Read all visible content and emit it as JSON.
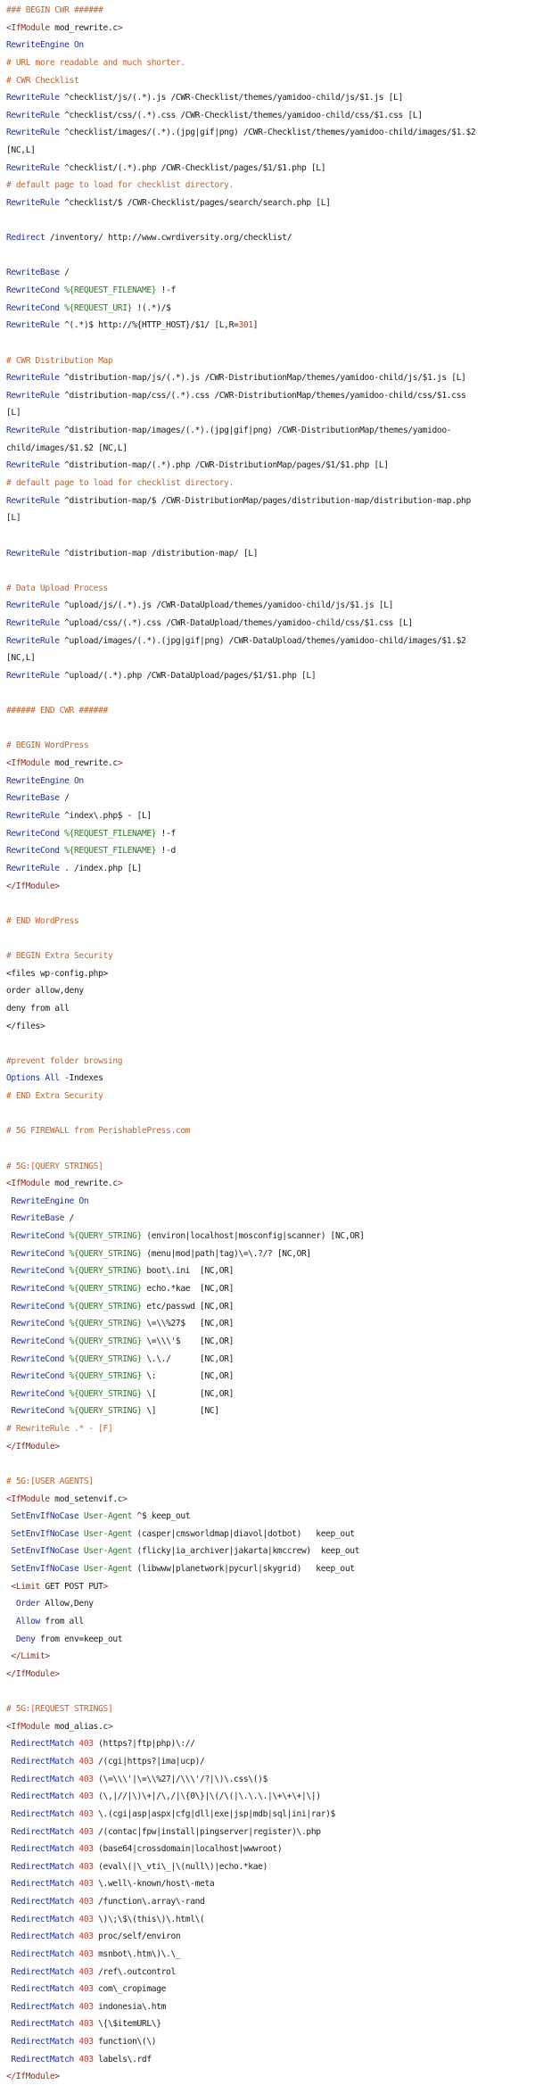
{
  "colors": {
    "comment": "#c0632e",
    "keyword": "#1f2fa0",
    "tag": "#8a2a1e",
    "variable": "#2f7a2a",
    "number": "#c0392b",
    "text": "#1a1a1a",
    "background": "#ffffff"
  },
  "lines": [
    [
      [
        "comment",
        "### BEGIN CWR ######"
      ]
    ],
    [
      [
        "tag",
        "<IfModule "
      ],
      [
        "text",
        "mod_rewrite.c"
      ],
      [
        "tag",
        ">"
      ]
    ],
    [
      [
        "keyword",
        "RewriteEngine On"
      ]
    ],
    [
      [
        "comment",
        "# URL more readable and much shorter."
      ]
    ],
    [
      [
        "comment",
        "# CWR Checklist"
      ]
    ],
    [
      [
        "keyword",
        "RewriteRule "
      ],
      [
        "text",
        "^checklist/js/(.*).js /CWR-Checklist/themes/yamidoo-child/js/$1.js [L]"
      ]
    ],
    [
      [
        "keyword",
        "RewriteRule "
      ],
      [
        "text",
        "^checklist/css/(.*).css /CWR-Checklist/themes/yamidoo-child/css/$1.css [L]"
      ]
    ],
    [
      [
        "keyword",
        "RewriteRule "
      ],
      [
        "text",
        "^checklist/images/(.*).(jpg|gif|png) /CWR-Checklist/themes/yamidoo-child/images/$1.$2"
      ]
    ],
    [
      [
        "text",
        "[NC,L]"
      ]
    ],
    [
      [
        "keyword",
        "RewriteRule "
      ],
      [
        "text",
        "^checklist/(.*).php /CWR-Checklist/pages/$1/$1.php [L]"
      ]
    ],
    [
      [
        "comment",
        "# default page to load for checklist directory."
      ]
    ],
    [
      [
        "keyword",
        "RewriteRule "
      ],
      [
        "text",
        "^checklist/$ /CWR-Checklist/pages/search/search.php [L]"
      ]
    ],
    [],
    [
      [
        "keyword",
        "Redirect "
      ],
      [
        "text",
        "/inventory/ http://www.cwrdiversity.org/checklist/"
      ]
    ],
    [],
    [
      [
        "keyword",
        "RewriteBase "
      ],
      [
        "text",
        "/"
      ]
    ],
    [
      [
        "keyword",
        "RewriteCond "
      ],
      [
        "var",
        "%{REQUEST_FILENAME}"
      ],
      [
        "text",
        " !-f"
      ]
    ],
    [
      [
        "keyword",
        "RewriteCond "
      ],
      [
        "var",
        "%{REQUEST_URI}"
      ],
      [
        "text",
        " !(.*)/$"
      ]
    ],
    [
      [
        "keyword",
        "RewriteRule "
      ],
      [
        "text",
        "^(.*)$ http://%{HTTP_HOST}/$1/ [L,R="
      ],
      [
        "num",
        "301"
      ],
      [
        "text",
        "]"
      ]
    ],
    [],
    [
      [
        "comment",
        "# CWR Distribution Map"
      ]
    ],
    [
      [
        "keyword",
        "RewriteRule "
      ],
      [
        "text",
        "^distribution-map/js/(.*).js /CWR-DistributionMap/themes/yamidoo-child/js/$1.js [L]"
      ]
    ],
    [
      [
        "keyword",
        "RewriteRule "
      ],
      [
        "text",
        "^distribution-map/css/(.*).css /CWR-DistributionMap/themes/yamidoo-child/css/$1.css"
      ]
    ],
    [
      [
        "text",
        "[L]"
      ]
    ],
    [
      [
        "keyword",
        "RewriteRule "
      ],
      [
        "text",
        "^distribution-map/images/(.*).(jpg|gif|png) /CWR-DistributionMap/themes/yamidoo-"
      ]
    ],
    [
      [
        "text",
        "child/images/$1.$2 [NC,L]"
      ]
    ],
    [
      [
        "keyword",
        "RewriteRule "
      ],
      [
        "text",
        "^distribution-map/(.*).php /CWR-DistributionMap/pages/$1/$1.php [L]"
      ]
    ],
    [
      [
        "comment",
        "# default page to load for checklist directory."
      ]
    ],
    [
      [
        "keyword",
        "RewriteRule "
      ],
      [
        "text",
        "^distribution-map/$ /CWR-DistributionMap/pages/distribution-map/distribution-map.php"
      ]
    ],
    [
      [
        "text",
        "[L]"
      ]
    ],
    [],
    [
      [
        "keyword",
        "RewriteRule "
      ],
      [
        "text",
        "^distribution-map /distribution-map/ [L]"
      ]
    ],
    [],
    [
      [
        "comment",
        "# Data Upload Process"
      ]
    ],
    [
      [
        "keyword",
        "RewriteRule "
      ],
      [
        "text",
        "^upload/js/(.*).js /CWR-DataUpload/themes/yamidoo-child/js/$1.js [L]"
      ]
    ],
    [
      [
        "keyword",
        "RewriteRule "
      ],
      [
        "text",
        "^upload/css/(.*).css /CWR-DataUpload/themes/yamidoo-child/css/$1.css [L]"
      ]
    ],
    [
      [
        "keyword",
        "RewriteRule "
      ],
      [
        "text",
        "^upload/images/(.*).(jpg|gif|png) /CWR-DataUpload/themes/yamidoo-child/images/$1.$2"
      ]
    ],
    [
      [
        "text",
        "[NC,L]"
      ]
    ],
    [
      [
        "keyword",
        "RewriteRule "
      ],
      [
        "text",
        "^upload/(.*).php /CWR-DataUpload/pages/$1/$1.php [L]"
      ]
    ],
    [],
    [
      [
        "comment",
        "###### END CWR ######"
      ]
    ],
    [],
    [
      [
        "comment",
        "# BEGIN WordPress"
      ]
    ],
    [
      [
        "tag",
        "<IfModule "
      ],
      [
        "text",
        "mod_rewrite.c"
      ],
      [
        "tag",
        ">"
      ]
    ],
    [
      [
        "keyword",
        "RewriteEngine On"
      ]
    ],
    [
      [
        "keyword",
        "RewriteBase "
      ],
      [
        "text",
        "/"
      ]
    ],
    [
      [
        "keyword",
        "RewriteRule "
      ],
      [
        "text",
        "^index\\.php$ - [L]"
      ]
    ],
    [
      [
        "keyword",
        "RewriteCond "
      ],
      [
        "var",
        "%{REQUEST_FILENAME}"
      ],
      [
        "text",
        " !-f"
      ]
    ],
    [
      [
        "keyword",
        "RewriteCond "
      ],
      [
        "var",
        "%{REQUEST_FILENAME}"
      ],
      [
        "text",
        " !-d"
      ]
    ],
    [
      [
        "keyword",
        "RewriteRule "
      ],
      [
        "text",
        ". /index.php [L]"
      ]
    ],
    [
      [
        "tag",
        "</IfModule>"
      ]
    ],
    [],
    [
      [
        "comment",
        "# END WordPress"
      ]
    ],
    [],
    [
      [
        "comment",
        "# BEGIN Extra Security"
      ]
    ],
    [
      [
        "text",
        "<files wp-config.php>"
      ]
    ],
    [
      [
        "text",
        "order allow,deny"
      ]
    ],
    [
      [
        "text",
        "deny from all"
      ]
    ],
    [
      [
        "text",
        "</files>"
      ]
    ],
    [],
    [
      [
        "comment",
        "#prevent folder browsing"
      ]
    ],
    [
      [
        "keyword",
        "Options All "
      ],
      [
        "text",
        "-Indexes"
      ]
    ],
    [
      [
        "comment",
        "# END Extra Security"
      ]
    ],
    [],
    [
      [
        "comment",
        "# 5G FIREWALL from PerishablePress.com"
      ]
    ],
    [],
    [
      [
        "comment",
        "# 5G:[QUERY STRINGS]"
      ]
    ],
    [
      [
        "tag",
        "<IfModule "
      ],
      [
        "text",
        "mod_rewrite.c"
      ],
      [
        "tag",
        ">"
      ]
    ],
    [
      [
        "keyword",
        " RewriteEngine On"
      ]
    ],
    [
      [
        "keyword",
        " RewriteBase "
      ],
      [
        "text",
        "/"
      ]
    ],
    [
      [
        "keyword",
        " RewriteCond "
      ],
      [
        "var",
        "%{QUERY_STRING}"
      ],
      [
        "text",
        " (environ|localhost|mosconfig|scanner) [NC,OR]"
      ]
    ],
    [
      [
        "keyword",
        " RewriteCond "
      ],
      [
        "var",
        "%{QUERY_STRING}"
      ],
      [
        "text",
        " (menu|mod|path|tag)\\=\\.?/? [NC,OR]"
      ]
    ],
    [
      [
        "keyword",
        " RewriteCond "
      ],
      [
        "var",
        "%{QUERY_STRING}"
      ],
      [
        "text",
        " boot\\.ini  [NC,OR]"
      ]
    ],
    [
      [
        "keyword",
        " RewriteCond "
      ],
      [
        "var",
        "%{QUERY_STRING}"
      ],
      [
        "text",
        " echo.*kae  [NC,OR]"
      ]
    ],
    [
      [
        "keyword",
        " RewriteCond "
      ],
      [
        "var",
        "%{QUERY_STRING}"
      ],
      [
        "text",
        " etc/passwd [NC,OR]"
      ]
    ],
    [
      [
        "keyword",
        " RewriteCond "
      ],
      [
        "var",
        "%{QUERY_STRING}"
      ],
      [
        "text",
        " \\=\\\\%27$   [NC,OR]"
      ]
    ],
    [
      [
        "keyword",
        " RewriteCond "
      ],
      [
        "var",
        "%{QUERY_STRING}"
      ],
      [
        "text",
        " \\=\\\\\\'$    [NC,OR]"
      ]
    ],
    [
      [
        "keyword",
        " RewriteCond "
      ],
      [
        "var",
        "%{QUERY_STRING}"
      ],
      [
        "text",
        " \\.\\./      [NC,OR]"
      ]
    ],
    [
      [
        "keyword",
        " RewriteCond "
      ],
      [
        "var",
        "%{QUERY_STRING}"
      ],
      [
        "text",
        " \\:         [NC,OR]"
      ]
    ],
    [
      [
        "keyword",
        " RewriteCond "
      ],
      [
        "var",
        "%{QUERY_STRING}"
      ],
      [
        "text",
        " \\[         [NC,OR]"
      ]
    ],
    [
      [
        "keyword",
        " RewriteCond "
      ],
      [
        "var",
        "%{QUERY_STRING}"
      ],
      [
        "text",
        " \\]         [NC]"
      ]
    ],
    [
      [
        "comment",
        "# RewriteRule .* - [F]"
      ]
    ],
    [
      [
        "tag",
        "</IfModule>"
      ]
    ],
    [],
    [
      [
        "comment",
        "# 5G:[USER AGENTS]"
      ]
    ],
    [
      [
        "tag",
        "<IfModule "
      ],
      [
        "text",
        "mod_setenvif.c"
      ],
      [
        "tag",
        ">"
      ]
    ],
    [
      [
        "keyword",
        " SetEnvIfNoCase "
      ],
      [
        "var",
        "User-Agent"
      ],
      [
        "text",
        " ^$ keep_out"
      ]
    ],
    [
      [
        "keyword",
        " SetEnvIfNoCase "
      ],
      [
        "var",
        "User-Agent"
      ],
      [
        "text",
        " (casper|cmsworldmap|diavol|dotbot)   keep_out"
      ]
    ],
    [
      [
        "keyword",
        " SetEnvIfNoCase "
      ],
      [
        "var",
        "User-Agent"
      ],
      [
        "text",
        " (flicky|ia_archiver|jakarta|kmccrew)  keep_out"
      ]
    ],
    [
      [
        "keyword",
        " SetEnvIfNoCase "
      ],
      [
        "var",
        "User-Agent"
      ],
      [
        "text",
        " (libwww|planetwork|pycurl|skygrid)   keep_out"
      ]
    ],
    [
      [
        "tag",
        " <Limit "
      ],
      [
        "text",
        "GET POST PUT"
      ],
      [
        "tag",
        ">"
      ]
    ],
    [
      [
        "keyword",
        "  Order "
      ],
      [
        "text",
        "Allow,Deny"
      ]
    ],
    [
      [
        "keyword",
        "  Allow "
      ],
      [
        "text",
        "from all"
      ]
    ],
    [
      [
        "keyword",
        "  Deny "
      ],
      [
        "text",
        "from env=keep_out"
      ]
    ],
    [
      [
        "tag",
        " </Limit>"
      ]
    ],
    [
      [
        "tag",
        "</IfModule>"
      ]
    ],
    [],
    [
      [
        "comment",
        "# 5G:[REQUEST STRINGS]"
      ]
    ],
    [
      [
        "tag",
        "<IfModule "
      ],
      [
        "text",
        "mod_alias.c"
      ],
      [
        "tag",
        ">"
      ]
    ],
    [
      [
        "keyword",
        " RedirectMatch "
      ],
      [
        "num",
        "403"
      ],
      [
        "text",
        " (https?|ftp|php)\\://"
      ]
    ],
    [
      [
        "keyword",
        " RedirectMatch "
      ],
      [
        "num",
        "403"
      ],
      [
        "text",
        " /(cgi|https?|ima|ucp)/"
      ]
    ],
    [
      [
        "keyword",
        " RedirectMatch "
      ],
      [
        "num",
        "403"
      ],
      [
        "text",
        " (\\=\\\\\\'|\\=\\\\%27|/\\\\\\'/?|\\)\\.css\\()$"
      ]
    ],
    [
      [
        "keyword",
        " RedirectMatch "
      ],
      [
        "num",
        "403"
      ],
      [
        "text",
        " (\\,|//|\\)\\+|/\\,/|\\{0\\}|\\(/\\(|\\.\\.\\.|\\+\\+\\+|\\|)"
      ]
    ],
    [
      [
        "keyword",
        " RedirectMatch "
      ],
      [
        "num",
        "403"
      ],
      [
        "text",
        " \\.(cgi|asp|aspx|cfg|dll|exe|jsp|mdb|sql|ini|rar)$"
      ]
    ],
    [
      [
        "keyword",
        " RedirectMatch "
      ],
      [
        "num",
        "403"
      ],
      [
        "text",
        " /(contac|fpw|install|pingserver|register)\\.php"
      ]
    ],
    [
      [
        "keyword",
        " RedirectMatch "
      ],
      [
        "num",
        "403"
      ],
      [
        "text",
        " (base64|crossdomain|localhost|wwwroot)"
      ]
    ],
    [
      [
        "keyword",
        " RedirectMatch "
      ],
      [
        "num",
        "403"
      ],
      [
        "text",
        " (eval\\(|\\_vti\\_|\\(null\\)|echo.*kae)"
      ]
    ],
    [
      [
        "keyword",
        " RedirectMatch "
      ],
      [
        "num",
        "403"
      ],
      [
        "text",
        " \\.well\\-known/host\\-meta"
      ]
    ],
    [
      [
        "keyword",
        " RedirectMatch "
      ],
      [
        "num",
        "403"
      ],
      [
        "text",
        " /function\\.array\\-rand"
      ]
    ],
    [
      [
        "keyword",
        " RedirectMatch "
      ],
      [
        "num",
        "403"
      ],
      [
        "text",
        " \\)\\;\\$\\(this\\)\\.html\\("
      ]
    ],
    [
      [
        "keyword",
        " RedirectMatch "
      ],
      [
        "num",
        "403"
      ],
      [
        "text",
        " proc/self/environ"
      ]
    ],
    [
      [
        "keyword",
        " RedirectMatch "
      ],
      [
        "num",
        "403"
      ],
      [
        "text",
        " msnbot\\.htm\\)\\.\\_"
      ]
    ],
    [
      [
        "keyword",
        " RedirectMatch "
      ],
      [
        "num",
        "403"
      ],
      [
        "text",
        " /ref\\.outcontrol"
      ]
    ],
    [
      [
        "keyword",
        " RedirectMatch "
      ],
      [
        "num",
        "403"
      ],
      [
        "text",
        " com\\_cropimage"
      ]
    ],
    [
      [
        "keyword",
        " RedirectMatch "
      ],
      [
        "num",
        "403"
      ],
      [
        "text",
        " indonesia\\.htm"
      ]
    ],
    [
      [
        "keyword",
        " RedirectMatch "
      ],
      [
        "num",
        "403"
      ],
      [
        "text",
        " \\{\\$itemURL\\}"
      ]
    ],
    [
      [
        "keyword",
        " RedirectMatch "
      ],
      [
        "num",
        "403"
      ],
      [
        "text",
        " function\\(\\)"
      ]
    ],
    [
      [
        "keyword",
        " RedirectMatch "
      ],
      [
        "num",
        "403"
      ],
      [
        "text",
        " labels\\.rdf"
      ]
    ],
    [
      [
        "tag",
        "</IfModule>"
      ]
    ]
  ]
}
